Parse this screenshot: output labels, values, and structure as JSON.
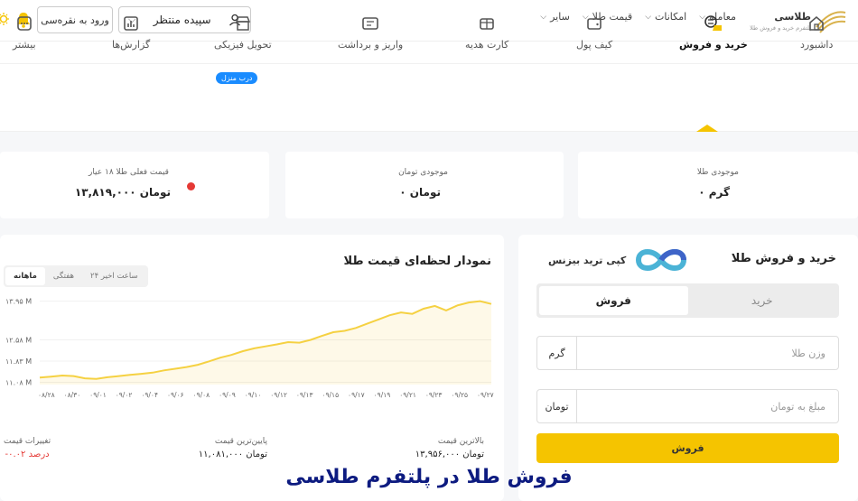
{
  "header": {
    "logo_name": "طلاسی",
    "logo_sub": "پلتفرم خرید و فروش طلا",
    "nav": [
      {
        "label": "معامله"
      },
      {
        "label": "امکانات"
      },
      {
        "label": "قیمت طلا"
      },
      {
        "label": "سایر"
      }
    ],
    "user_name": "سپیده منتظر",
    "login_label": "ورود به نقره‌سی"
  },
  "tabs": [
    {
      "label": "داشبورد",
      "icon": "home-icon"
    },
    {
      "label": "خرید و فروش",
      "icon": "exchange-icon",
      "active": true
    },
    {
      "label": "کیف پول",
      "icon": "wallet-icon"
    },
    {
      "label": "کارت هدیه",
      "icon": "gift-card-icon"
    },
    {
      "label": "واریز و برداشت",
      "icon": "deposit-icon"
    },
    {
      "label": "تحویل فیزیکی",
      "icon": "store-icon"
    },
    {
      "label": "گزارش‌ها",
      "icon": "report-icon"
    },
    {
      "label": "بیشتر",
      "icon": "more-icon"
    }
  ],
  "badge": "درب منزل",
  "stats": {
    "gold_label": "موجودی طلا",
    "gold_value": "۰ گرم",
    "toman_label": "موجودی تومان",
    "toman_value": "۰ تومان",
    "price_label": "قیمت فعلی طلا ۱۸ عیار",
    "price_value": "۱۳,۸۱۹,۰۰۰ تومان"
  },
  "trade": {
    "title": "خرید و فروش طلا",
    "brand": "کپی ترید بیزنس",
    "buy_label": "خرید",
    "sell_label": "فروش",
    "weight_placeholder": "وزن طلا",
    "weight_unit": "گرم",
    "amount_placeholder": "مبلغ به تومان",
    "amount_unit": "تومان",
    "submit_label": "فروش"
  },
  "chart_panel": {
    "title": "نمودار لحظه‌ای قیمت طلا",
    "ranges": [
      {
        "label": "۲۴ ساعت اخیر"
      },
      {
        "label": "هفتگی"
      },
      {
        "label": "ماهانه",
        "active": true
      }
    ],
    "max_label": "بالاترین قیمت",
    "max_value": "۱۳,۹۵۶,۰۰۰ تومان",
    "min_label": "پایین‌ترین قیمت",
    "min_value": "۱۱,۰۸۱,۰۰۰ تومان",
    "change_label": "تغییرات قیمت",
    "change_value": "-۰.۰۲ درصد"
  },
  "chart_data": {
    "type": "line",
    "y_ticks": [
      "۱۳.۹۵ M",
      "۱۲.۵۸ M",
      "۱۱.۸۳ M",
      "۱۱.۰۸ M"
    ],
    "y_tick_values": [
      13.95,
      12.58,
      11.83,
      11.08
    ],
    "ylim": [
      11.0,
      14.0
    ],
    "x_ticks": [
      "۰۸/۲۸",
      "۰۸/۳۰",
      "۰۹/۰۱",
      "۰۹/۰۲",
      "۰۹/۰۴",
      "۰۹/۰۶",
      "۰۹/۰۸",
      "۰۹/۰۹",
      "۰۹/۱۰",
      "۰۹/۱۲",
      "۰۹/۱۳",
      "۰۹/۱۵",
      "۰۹/۱۷",
      "۰۹/۱۹",
      "۰۹/۲۱",
      "۰۹/۲۳",
      "۰۹/۲۵",
      "۰۹/۲۷"
    ],
    "values": [
      11.25,
      11.28,
      11.32,
      11.3,
      11.22,
      11.2,
      11.26,
      11.3,
      11.34,
      11.38,
      11.42,
      11.5,
      11.56,
      11.62,
      11.7,
      11.82,
      11.95,
      12.05,
      12.18,
      12.28,
      12.35,
      12.42,
      12.5,
      12.48,
      12.58,
      12.72,
      12.85,
      12.9,
      13.0,
      13.15,
      13.3,
      13.45,
      13.55,
      13.5,
      13.68,
      13.78,
      13.62,
      13.8,
      13.9,
      13.95,
      13.85
    ],
    "color": "#f5d142"
  },
  "caption": "فروش طلا در پلتفرم طلاسی"
}
